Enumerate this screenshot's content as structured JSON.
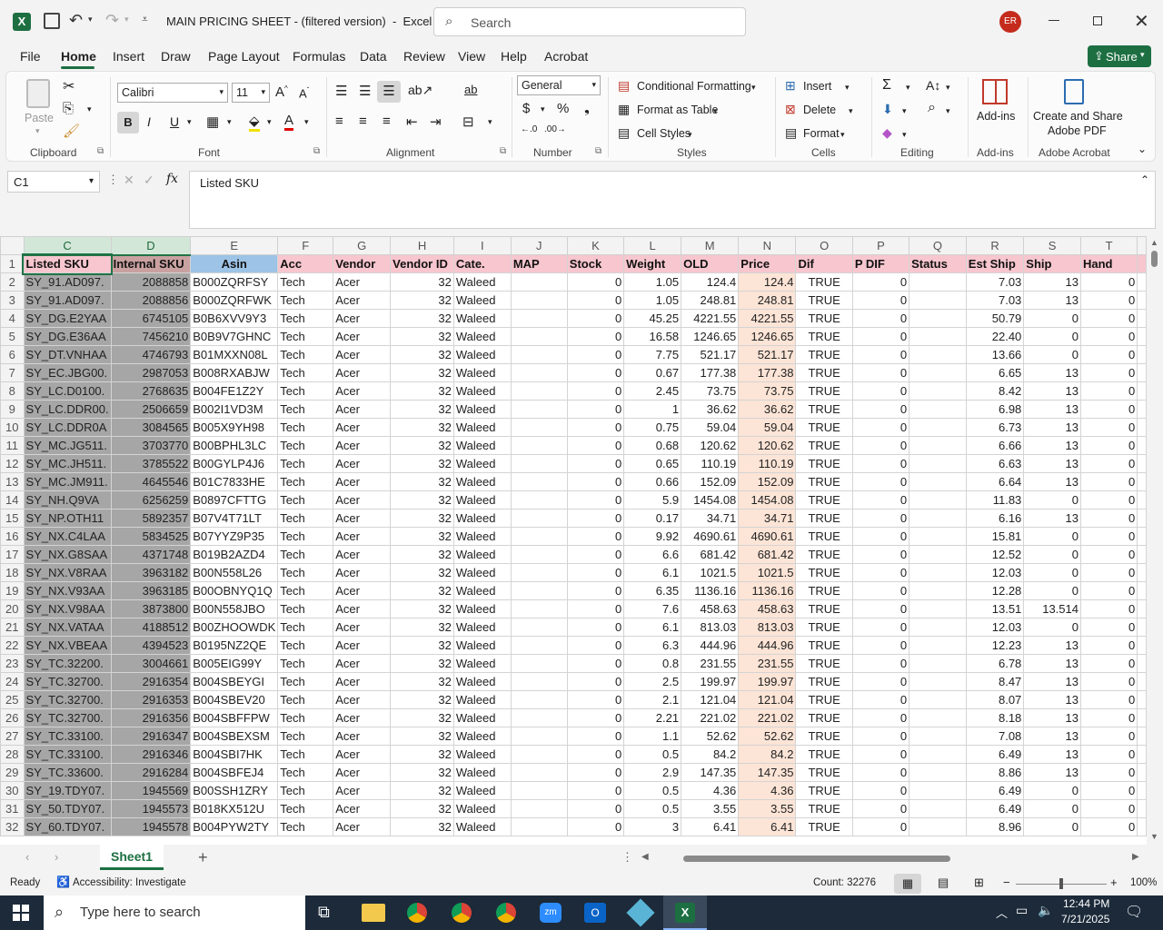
{
  "window": {
    "title": "MAIN PRICING SHEET - (filtered version)  -  Excel",
    "search_placeholder": "Search",
    "user_initials": "ER"
  },
  "menu": [
    "File",
    "Home",
    "Insert",
    "Draw",
    "Page Layout",
    "Formulas",
    "Data",
    "Review",
    "View",
    "Help",
    "Acrobat"
  ],
  "share_label": "Share",
  "ribbon": {
    "clipboard": {
      "paste": "Paste",
      "label": "Clipboard"
    },
    "font": {
      "name": "Calibri",
      "size": "11",
      "label": "Font"
    },
    "alignment": {
      "label": "Alignment"
    },
    "number": {
      "format": "General",
      "label": "Number"
    },
    "styles": {
      "conditional": "Conditional Formatting",
      "format_table": "Format as Table",
      "cell_styles": "Cell Styles",
      "label": "Styles"
    },
    "cells": {
      "insert": "Insert",
      "delete": "Delete",
      "format": "Format",
      "label": "Cells"
    },
    "editing": {
      "label": "Editing"
    },
    "addins": {
      "btn": "Add-ins",
      "label": "Add-ins"
    },
    "acrobat": {
      "btn1": "Create and Share",
      "btn2": "Adobe PDF",
      "label": "Adobe Acrobat"
    }
  },
  "formula_bar": {
    "name_box": "C1",
    "formula": "Listed SKU"
  },
  "columns": [
    "C",
    "D",
    "E",
    "F",
    "G",
    "H",
    "I",
    "J",
    "K",
    "L",
    "M",
    "N",
    "O",
    "P",
    "Q",
    "R",
    "S",
    "T"
  ],
  "headers": [
    "Listed SKU",
    "Internal SKU",
    "Asin",
    "Acc",
    "Vendor",
    "Vendor ID",
    "Cate.",
    "MAP",
    "Stock",
    "Weight",
    "OLD",
    "Price",
    "Dif",
    "P DIF",
    "Status",
    "Est Ship",
    "Ship",
    "Hand"
  ],
  "rows": [
    [
      "SY_91.AD097.",
      "2088858",
      "B000ZQRFSY",
      "Tech",
      "Acer",
      "32",
      "Waleed",
      "",
      "0",
      "1.05",
      "124.4",
      "124.4",
      "TRUE",
      "0",
      "",
      "7.03",
      "13",
      "0"
    ],
    [
      "SY_91.AD097.",
      "2088856",
      "B000ZQRFWK",
      "Tech",
      "Acer",
      "32",
      "Waleed",
      "",
      "0",
      "1.05",
      "248.81",
      "248.81",
      "TRUE",
      "0",
      "",
      "7.03",
      "13",
      "0"
    ],
    [
      "SY_DG.E2YAA",
      "6745105",
      "B0B6XVV9Y3",
      "Tech",
      "Acer",
      "32",
      "Waleed",
      "",
      "0",
      "45.25",
      "4221.55",
      "4221.55",
      "TRUE",
      "0",
      "",
      "50.79",
      "0",
      "0"
    ],
    [
      "SY_DG.E36AA",
      "7456210",
      "B0B9V7GHNC",
      "Tech",
      "Acer",
      "32",
      "Waleed",
      "",
      "0",
      "16.58",
      "1246.65",
      "1246.65",
      "TRUE",
      "0",
      "",
      "22.40",
      "0",
      "0"
    ],
    [
      "SY_DT.VNHAA",
      "4746793",
      "B01MXXN08L",
      "Tech",
      "Acer",
      "32",
      "Waleed",
      "",
      "0",
      "7.75",
      "521.17",
      "521.17",
      "TRUE",
      "0",
      "",
      "13.66",
      "0",
      "0"
    ],
    [
      "SY_EC.JBG00.",
      "2987053",
      "B008RXABJW",
      "Tech",
      "Acer",
      "32",
      "Waleed",
      "",
      "0",
      "0.67",
      "177.38",
      "177.38",
      "TRUE",
      "0",
      "",
      "6.65",
      "13",
      "0"
    ],
    [
      "SY_LC.D0100.",
      "2768635",
      "B004FE1Z2Y",
      "Tech",
      "Acer",
      "32",
      "Waleed",
      "",
      "0",
      "2.45",
      "73.75",
      "73.75",
      "TRUE",
      "0",
      "",
      "8.42",
      "13",
      "0"
    ],
    [
      "SY_LC.DDR00.",
      "2506659",
      "B002I1VD3M",
      "Tech",
      "Acer",
      "32",
      "Waleed",
      "",
      "0",
      "1",
      "36.62",
      "36.62",
      "TRUE",
      "0",
      "",
      "6.98",
      "13",
      "0"
    ],
    [
      "SY_LC.DDR0A",
      "3084565",
      "B005X9YH98",
      "Tech",
      "Acer",
      "32",
      "Waleed",
      "",
      "0",
      "0.75",
      "59.04",
      "59.04",
      "TRUE",
      "0",
      "",
      "6.73",
      "13",
      "0"
    ],
    [
      "SY_MC.JG511.",
      "3703770",
      "B00BPHL3LC",
      "Tech",
      "Acer",
      "32",
      "Waleed",
      "",
      "0",
      "0.68",
      "120.62",
      "120.62",
      "TRUE",
      "0",
      "",
      "6.66",
      "13",
      "0"
    ],
    [
      "SY_MC.JH511.",
      "3785522",
      "B00GYLP4J6",
      "Tech",
      "Acer",
      "32",
      "Waleed",
      "",
      "0",
      "0.65",
      "110.19",
      "110.19",
      "TRUE",
      "0",
      "",
      "6.63",
      "13",
      "0"
    ],
    [
      "SY_MC.JM911.",
      "4645546",
      "B01C7833HE",
      "Tech",
      "Acer",
      "32",
      "Waleed",
      "",
      "0",
      "0.66",
      "152.09",
      "152.09",
      "TRUE",
      "0",
      "",
      "6.64",
      "13",
      "0"
    ],
    [
      "SY_NH.Q9VA",
      "6256259",
      "B0897CFTTG",
      "Tech",
      "Acer",
      "32",
      "Waleed",
      "",
      "0",
      "5.9",
      "1454.08",
      "1454.08",
      "TRUE",
      "0",
      "",
      "11.83",
      "0",
      "0"
    ],
    [
      "SY_NP.OTH11",
      "5892357",
      "B07V4T71LT",
      "Tech",
      "Acer",
      "32",
      "Waleed",
      "",
      "0",
      "0.17",
      "34.71",
      "34.71",
      "TRUE",
      "0",
      "",
      "6.16",
      "13",
      "0"
    ],
    [
      "SY_NX.C4LAA",
      "5834525",
      "B07YYZ9P35",
      "Tech",
      "Acer",
      "32",
      "Waleed",
      "",
      "0",
      "9.92",
      "4690.61",
      "4690.61",
      "TRUE",
      "0",
      "",
      "15.81",
      "0",
      "0"
    ],
    [
      "SY_NX.G8SAA",
      "4371748",
      "B019B2AZD4",
      "Tech",
      "Acer",
      "32",
      "Waleed",
      "",
      "0",
      "6.6",
      "681.42",
      "681.42",
      "TRUE",
      "0",
      "",
      "12.52",
      "0",
      "0"
    ],
    [
      "SY_NX.V8RAA",
      "3963182",
      "B00N558L26",
      "Tech",
      "Acer",
      "32",
      "Waleed",
      "",
      "0",
      "6.1",
      "1021.5",
      "1021.5",
      "TRUE",
      "0",
      "",
      "12.03",
      "0",
      "0"
    ],
    [
      "SY_NX.V93AA",
      "3963185",
      "B00OBNYQ1Q",
      "Tech",
      "Acer",
      "32",
      "Waleed",
      "",
      "0",
      "6.35",
      "1136.16",
      "1136.16",
      "TRUE",
      "0",
      "",
      "12.28",
      "0",
      "0"
    ],
    [
      "SY_NX.V98AA",
      "3873800",
      "B00N558JBO",
      "Tech",
      "Acer",
      "32",
      "Waleed",
      "",
      "0",
      "7.6",
      "458.63",
      "458.63",
      "TRUE",
      "0",
      "",
      "13.51",
      "13.514",
      "0"
    ],
    [
      "SY_NX.VATAA",
      "4188512",
      "B00ZHOOWDK",
      "Tech",
      "Acer",
      "32",
      "Waleed",
      "",
      "0",
      "6.1",
      "813.03",
      "813.03",
      "TRUE",
      "0",
      "",
      "12.03",
      "0",
      "0"
    ],
    [
      "SY_NX.VBEAA",
      "4394523",
      "B0195NZ2QE",
      "Tech",
      "Acer",
      "32",
      "Waleed",
      "",
      "0",
      "6.3",
      "444.96",
      "444.96",
      "TRUE",
      "0",
      "",
      "12.23",
      "13",
      "0"
    ],
    [
      "SY_TC.32200.",
      "3004661",
      "B005EIG99Y",
      "Tech",
      "Acer",
      "32",
      "Waleed",
      "",
      "0",
      "0.8",
      "231.55",
      "231.55",
      "TRUE",
      "0",
      "",
      "6.78",
      "13",
      "0"
    ],
    [
      "SY_TC.32700.",
      "2916354",
      "B004SBEYGI",
      "Tech",
      "Acer",
      "32",
      "Waleed",
      "",
      "0",
      "2.5",
      "199.97",
      "199.97",
      "TRUE",
      "0",
      "",
      "8.47",
      "13",
      "0"
    ],
    [
      "SY_TC.32700.",
      "2916353",
      "B004SBEV20",
      "Tech",
      "Acer",
      "32",
      "Waleed",
      "",
      "0",
      "2.1",
      "121.04",
      "121.04",
      "TRUE",
      "0",
      "",
      "8.07",
      "13",
      "0"
    ],
    [
      "SY_TC.32700.",
      "2916356",
      "B004SBFFPW",
      "Tech",
      "Acer",
      "32",
      "Waleed",
      "",
      "0",
      "2.21",
      "221.02",
      "221.02",
      "TRUE",
      "0",
      "",
      "8.18",
      "13",
      "0"
    ],
    [
      "SY_TC.33100.",
      "2916347",
      "B004SBEXSM",
      "Tech",
      "Acer",
      "32",
      "Waleed",
      "",
      "0",
      "1.1",
      "52.62",
      "52.62",
      "TRUE",
      "0",
      "",
      "7.08",
      "13",
      "0"
    ],
    [
      "SY_TC.33100.",
      "2916346",
      "B004SBI7HK",
      "Tech",
      "Acer",
      "32",
      "Waleed",
      "",
      "0",
      "0.5",
      "84.2",
      "84.2",
      "TRUE",
      "0",
      "",
      "6.49",
      "13",
      "0"
    ],
    [
      "SY_TC.33600.",
      "2916284",
      "B004SBFEJ4",
      "Tech",
      "Acer",
      "32",
      "Waleed",
      "",
      "0",
      "2.9",
      "147.35",
      "147.35",
      "TRUE",
      "0",
      "",
      "8.86",
      "13",
      "0"
    ],
    [
      "SY_19.TDY07.",
      "1945569",
      "B00SSH1ZRY",
      "Tech",
      "Acer",
      "32",
      "Waleed",
      "",
      "0",
      "0.5",
      "4.36",
      "4.36",
      "TRUE",
      "0",
      "",
      "6.49",
      "0",
      "0"
    ],
    [
      "SY_50.TDY07.",
      "1945573",
      "B018KX512U",
      "Tech",
      "Acer",
      "32",
      "Waleed",
      "",
      "0",
      "0.5",
      "3.55",
      "3.55",
      "TRUE",
      "0",
      "",
      "6.49",
      "0",
      "0"
    ],
    [
      "SY_60.TDY07.",
      "1945578",
      "B004PYW2TY",
      "Tech",
      "Acer",
      "32",
      "Waleed",
      "",
      "0",
      "3",
      "6.41",
      "6.41",
      "TRUE",
      "0",
      "",
      "8.96",
      "0",
      "0"
    ]
  ],
  "row_numbers": [
    "1",
    "2",
    "3",
    "4",
    "5",
    "6",
    "7",
    "8",
    "9",
    "10",
    "11",
    "12",
    "13",
    "14",
    "15",
    "16",
    "17",
    "18",
    "19",
    "20",
    "21",
    "22",
    "23",
    "24",
    "25",
    "26",
    "27",
    "28",
    "29",
    "30",
    "31",
    "32"
  ],
  "sheet_tab": "Sheet1",
  "status": {
    "ready": "Ready",
    "accessibility": "Accessibility: Investigate",
    "count": "Count: 32276",
    "zoom": "100%"
  },
  "taskbar": {
    "search_placeholder": "Type here to search",
    "time": "12:44 PM",
    "date": "7/21/2025"
  }
}
